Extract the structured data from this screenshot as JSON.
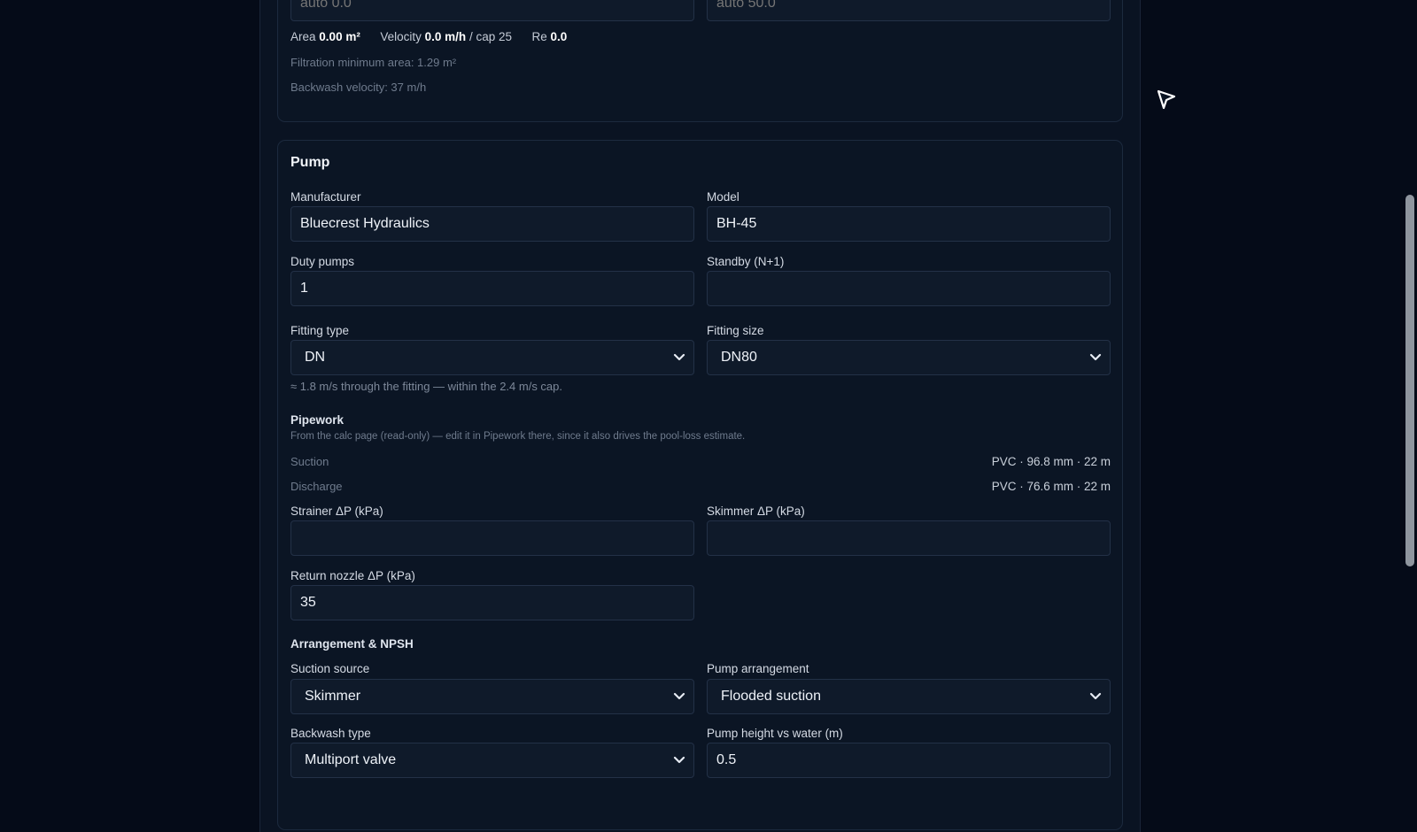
{
  "filtration": {
    "area_input_placeholder": "auto 0.0",
    "velocity_input_placeholder": "auto 50.0",
    "area_label": "Area",
    "area_value": "0.00 m²",
    "velocity_label": "Velocity",
    "velocity_value": "0.0 m/h",
    "velocity_cap": "/ cap 25",
    "re_label": "Re",
    "re_value": "0.0",
    "min_area_note": "Filtration minimum area: 1.29 m²",
    "backwash_velocity_note": "Backwash velocity: 37 m/h"
  },
  "pump": {
    "title": "Pump",
    "manufacturer_label": "Manufacturer",
    "manufacturer_value": "Bluecrest Hydraulics",
    "model_label": "Model",
    "model_value": "BH-45",
    "duty_pumps_label": "Duty pumps",
    "duty_pumps_value": "1",
    "standby_label": "Standby (N+1)",
    "standby_value": "",
    "fitting_type_label": "Fitting type",
    "fitting_type_value": "DN",
    "fitting_size_label": "Fitting size",
    "fitting_size_value": "DN80",
    "fitting_hint": "≈ 1.8 m/s through the fitting — within the 2.4 m/s cap."
  },
  "pipework": {
    "title": "Pipework",
    "note": "From the calc page (read-only) — edit it in Pipework there, since it also drives the pool-loss estimate.",
    "suction_label": "Suction",
    "suction_value": "PVC · 96.8 mm · 22 m",
    "discharge_label": "Discharge",
    "discharge_value": "PVC · 76.6 mm · 22 m",
    "strainer_label": "Strainer ΔP (kPa)",
    "strainer_value": "",
    "skimmer_label": "Skimmer ΔP (kPa)",
    "skimmer_value": "",
    "return_nozzle_label": "Return nozzle ΔP (kPa)",
    "return_nozzle_value": "35"
  },
  "arrangement": {
    "title": "Arrangement & NPSH",
    "suction_source_label": "Suction source",
    "suction_source_value": "Skimmer",
    "pump_arrangement_label": "Pump arrangement",
    "pump_arrangement_value": "Flooded suction",
    "backwash_type_label": "Backwash type",
    "backwash_type_value": "Multiport valve",
    "pump_height_label": "Pump height vs water (m)",
    "pump_height_value": "0.5"
  },
  "colors": {
    "background": "#050b18",
    "panel": "#0a1322",
    "input": "#0f1a2a",
    "border": "#233147"
  }
}
